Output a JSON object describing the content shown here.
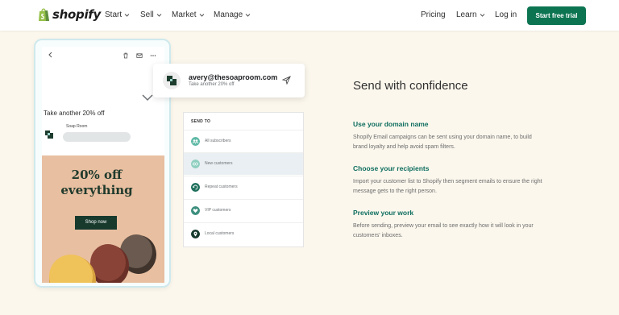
{
  "nav": {
    "brand": "shopify",
    "items": [
      {
        "label": "Start",
        "has_caret": true
      },
      {
        "label": "Sell",
        "has_caret": true
      },
      {
        "label": "Market",
        "has_caret": true
      },
      {
        "label": "Manage",
        "has_caret": true
      }
    ],
    "right_items": [
      {
        "label": "Pricing",
        "has_caret": false
      },
      {
        "label": "Learn",
        "has_caret": true
      },
      {
        "label": "Log in",
        "has_caret": false
      }
    ],
    "cta_label": "Start free trial",
    "cta_color": "#0d7452"
  },
  "phone": {
    "subject": "Take another 20% off",
    "sender_name": "Soap Room",
    "promo_title_line1": "20% off",
    "promo_title_line2": "everything",
    "promo_button": "Shop now",
    "promo_bg": "#e8bfa1"
  },
  "sender_card": {
    "email": "avery@thesoaproom.com",
    "subtitle": "Take another 20% off"
  },
  "send_to": {
    "title": "SEND TO",
    "rows": [
      {
        "label": "All subscribers",
        "icon": "audience-icon",
        "active": false
      },
      {
        "label": "New customers",
        "icon": "new-customer-icon",
        "active": true
      },
      {
        "label": "Repeat customers",
        "icon": "repeat-icon",
        "active": false
      },
      {
        "label": "VIP customers",
        "icon": "heart-icon",
        "active": false
      },
      {
        "label": "Local customers",
        "icon": "location-pin-icon",
        "active": false
      }
    ]
  },
  "content": {
    "heading": "Send with confidence",
    "features": [
      {
        "title": "Use your domain name",
        "body": "Shopify Email campaigns can be sent using your domain name, to build brand loyalty and help avoid spam filters."
      },
      {
        "title": "Choose your recipients",
        "body": "Import your customer list to Shopify then segment emails to ensure the right message gets to the right person."
      },
      {
        "title": "Preview your work",
        "body": "Before sending, preview your email to see exactly how it will look in your customers' inboxes."
      }
    ],
    "accent_color": "#0f6e5f"
  }
}
